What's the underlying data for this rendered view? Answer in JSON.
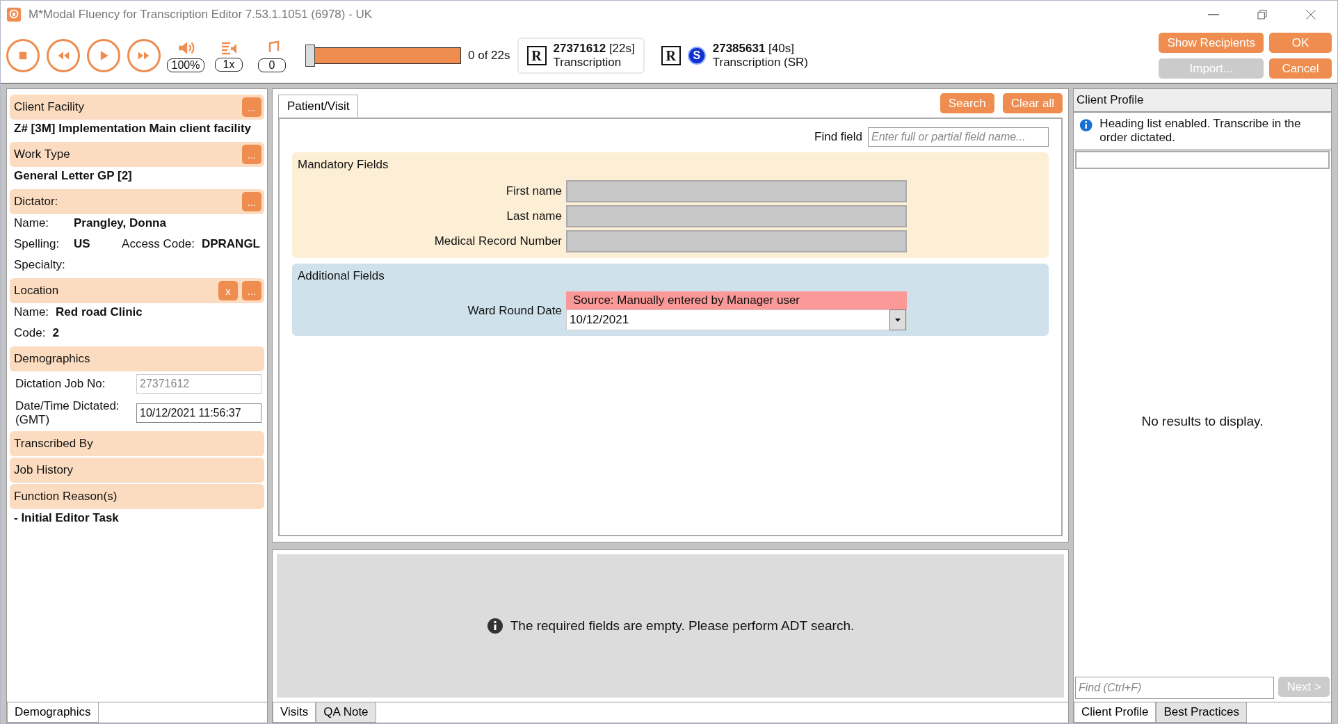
{
  "window": {
    "title": "M*Modal Fluency for Transcription Editor 7.53.1.1051 (6978) - UK"
  },
  "player": {
    "volume": "100%",
    "speed": "1x",
    "pitch": "0",
    "level": 0,
    "position": "0 of 22s"
  },
  "jobs": [
    {
      "number": "27371612",
      "duration": "[22s]",
      "type": "Transcription",
      "selected": true,
      "marks": [
        {
          "kind": "box",
          "text": "R"
        }
      ]
    },
    {
      "number": "27385631",
      "duration": "[40s]",
      "type": "Transcription (SR)",
      "selected": false,
      "marks": [
        {
          "kind": "box",
          "text": "R"
        },
        {
          "kind": "circle",
          "text": "S"
        }
      ]
    }
  ],
  "actions": [
    {
      "label": "Show Recipients",
      "disabled": false
    },
    {
      "label": "OK",
      "disabled": false
    },
    {
      "label": "Import...",
      "disabled": true
    },
    {
      "label": "Cancel",
      "disabled": false
    }
  ],
  "sidebar": {
    "sections": [
      {
        "title": "Client Facility",
        "buttons": [
          "..."
        ],
        "rows": [
          {
            "kind": "bold",
            "text": "Z# [3M] Implementation Main client facility"
          }
        ]
      },
      {
        "title": "Work Type",
        "buttons": [
          "..."
        ],
        "rows": [
          {
            "kind": "bold",
            "text": "General Letter GP [2]"
          }
        ]
      },
      {
        "title": "Dictator:",
        "buttons": [
          "..."
        ],
        "rows": [
          {
            "kind": "pair",
            "label": "Name:",
            "value": "Prangley, Donna"
          },
          {
            "kind": "pair2",
            "label": "Spelling:",
            "value": "US",
            "label2": "Access Code:",
            "value2": "DPRANGL"
          },
          {
            "kind": "pair",
            "label": "Specialty:"
          }
        ]
      },
      {
        "title": "Location",
        "buttons": [
          "x",
          "..."
        ],
        "rows": [
          {
            "kind": "short",
            "label": "Name:",
            "value": "Red road Clinic"
          },
          {
            "kind": "short",
            "label": "Code:",
            "value": "2"
          }
        ]
      },
      {
        "title": "Demographics",
        "rows": [
          {
            "kind": "field",
            "label": "Dictation Job No:",
            "value": "27371612",
            "disabled": true
          },
          {
            "kind": "field",
            "label": "Date/Time Dictated: (GMT)",
            "value": "10/12/2021 11:56:37",
            "disabled": false
          }
        ]
      },
      {
        "title": "Transcribed By"
      },
      {
        "title": "Job History"
      },
      {
        "title": "Function Reason(s)",
        "rows": [
          {
            "kind": "bold",
            "text": "- Initial Editor Task"
          }
        ]
      }
    ],
    "tabs": [
      {
        "label": "Demographics",
        "selected": true
      }
    ]
  },
  "patient": {
    "tabs": [
      {
        "label": "Patient/Visit",
        "selected": true
      }
    ],
    "buttons": [
      "Search",
      "Clear all"
    ],
    "find_field": {
      "label": "Find field",
      "placeholder": "Enter full or partial field name..."
    },
    "groups": [
      {
        "kind": "mandatory",
        "title": "Mandatory Fields",
        "fields": [
          {
            "label": "First name",
            "disabled": true
          },
          {
            "label": "Last name",
            "disabled": true
          },
          {
            "label": "Medical Record Number",
            "disabled": true
          }
        ]
      },
      {
        "kind": "additional",
        "title": "Additional Fields",
        "fields": [
          {
            "label": "Ward Round Date",
            "disabled": false,
            "source": "Source: Manually entered by Manager user",
            "value": "10/12/2021"
          }
        ]
      }
    ]
  },
  "visits": {
    "message": "The required fields are empty. Please perform ADT search.",
    "tabs": [
      {
        "label": "Visits",
        "selected": true
      },
      {
        "label": "QA Note",
        "selected": false
      }
    ]
  },
  "profile": {
    "title": "Client Profile",
    "info": "Heading list enabled. Transcribe in the order dictated.",
    "empty": "No results to display.",
    "find_placeholder": "Find (Ctrl+F)",
    "next": {
      "label": "Next >",
      "disabled": true
    },
    "tabs": [
      {
        "label": "Client Profile",
        "selected": true
      },
      {
        "label": "Best Practices",
        "selected": false
      }
    ]
  }
}
